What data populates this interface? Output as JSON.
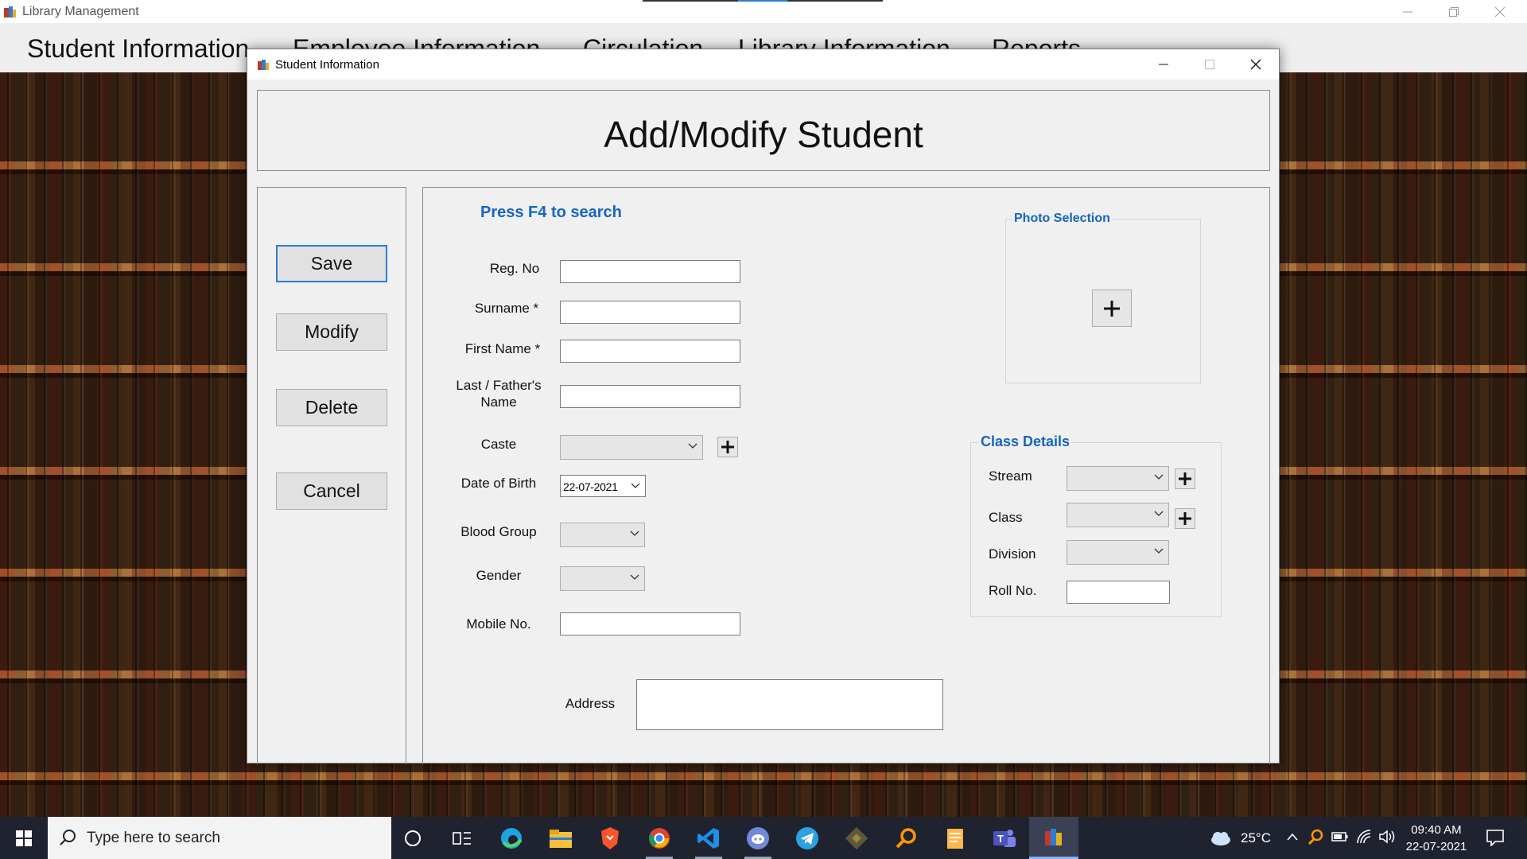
{
  "app": {
    "title": "Library Management"
  },
  "menu": [
    "Student Information",
    "Employee Information",
    "Circulation",
    "Library Information",
    "Reports"
  ],
  "dialog": {
    "title": "Student Information",
    "header": "Add/Modify Student"
  },
  "actions": {
    "save": "Save",
    "modify": "Modify",
    "delete": "Delete",
    "cancel": "Cancel"
  },
  "form": {
    "hint": "Press F4 to search",
    "reg_no": {
      "label": "Reg. No",
      "value": ""
    },
    "surname": {
      "label": "Surname *",
      "value": ""
    },
    "first_name": {
      "label": "First Name *",
      "value": ""
    },
    "last_name": {
      "label_line1": "Last / Father's",
      "label_line2": "Name",
      "value": ""
    },
    "caste": {
      "label": "Caste",
      "value": ""
    },
    "dob": {
      "label": "Date of Birth",
      "value": "22-07-2021"
    },
    "blood_group": {
      "label": "Blood Group",
      "value": ""
    },
    "gender": {
      "label": "Gender",
      "value": ""
    },
    "mobile": {
      "label": "Mobile No.",
      "value": ""
    },
    "address": {
      "label": "Address",
      "value": ""
    }
  },
  "photo": {
    "title": "Photo Selection"
  },
  "class_details": {
    "title": "Class Details",
    "stream": {
      "label": "Stream",
      "value": ""
    },
    "class": {
      "label": "Class",
      "value": ""
    },
    "division": {
      "label": "Division",
      "value": ""
    },
    "roll_no": {
      "label": "Roll No.",
      "value": ""
    }
  },
  "taskbar": {
    "search_placeholder": "Type here to search",
    "apps": [
      "cortana-icon",
      "task-view-icon",
      "edge-icon",
      "file-explorer-icon",
      "brave-icon",
      "chrome-icon",
      "vscode-icon",
      "discord-icon",
      "telegram-icon",
      "git-icon",
      "search-tool-icon",
      "notepad-icon",
      "teams-icon",
      "library-app-icon"
    ],
    "temperature": "25°C",
    "time": "09:40 AM",
    "date": "22-07-2021"
  },
  "colors": {
    "accent": "#1565c0",
    "focus": "#2d7dd2",
    "taskbar": "#1f2330",
    "dialog_bg": "#f0f0f0"
  }
}
